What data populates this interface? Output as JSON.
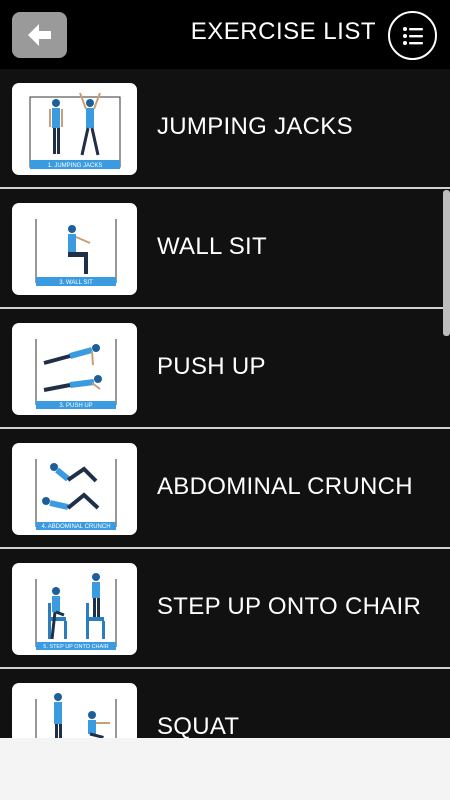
{
  "header": {
    "title": "EXERCISE LIST",
    "back_icon": "arrow-left-icon",
    "menu_icon": "list-icon"
  },
  "exercises": [
    {
      "label": "JUMPING JACKS",
      "caption": "1. JUMPING JACKS"
    },
    {
      "label": "WALL SIT",
      "caption": "3. WALL SIT"
    },
    {
      "label": "PUSH UP",
      "caption": "3. PUSH UP"
    },
    {
      "label": "ABDOMINAL CRUNCH",
      "caption": "4. ABDOMINAL CRUNCH"
    },
    {
      "label": "STEP UP ONTO CHAIR",
      "caption": "5. STEP UP ONTO CHAIR"
    },
    {
      "label": "SQUAT",
      "caption": ""
    }
  ],
  "colors": {
    "background": "#111111",
    "header": "#000000",
    "accent": "#3a9be0",
    "back_button": "#9a9a9a"
  }
}
